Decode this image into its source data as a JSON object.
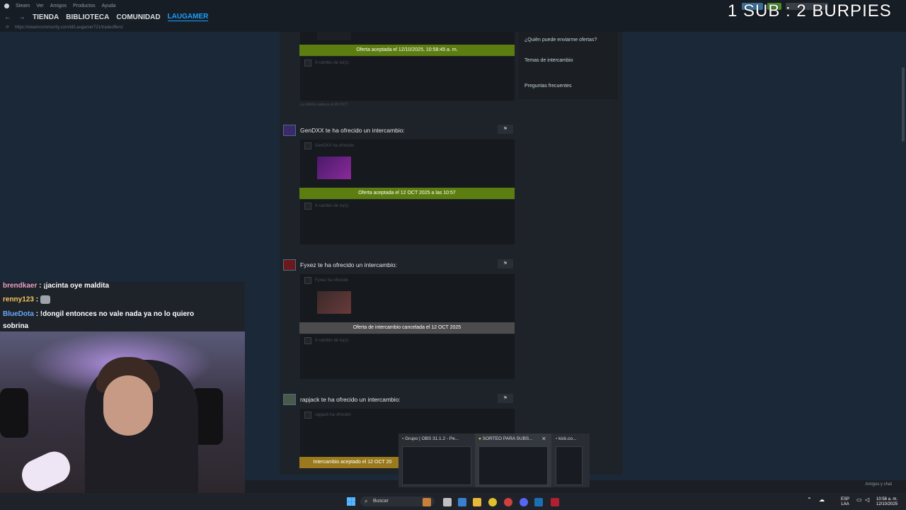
{
  "menubar": {
    "items": [
      "Steam",
      "Ver",
      "Amigos",
      "Productos",
      "Ayuda"
    ]
  },
  "navbar": {
    "back": "←",
    "forward": "→",
    "items": [
      "TIENDA",
      "BIBLIOTECA",
      "COMUNIDAD",
      "LAUGAMER"
    ]
  },
  "url": "https://steamcommunity.com/id/Laugamer721/tradeoffers/",
  "banner": "1 SUB : 2 BURPIES",
  "sidebar": {
    "links": [
      "¿Quién puede enviarme ofertas?",
      "Temas de intercambio",
      "Preguntas frecuentes"
    ]
  },
  "offers": [
    {
      "status": "Oferta aceptada el 12/10/2025, 10:58:45 a. m.",
      "receive_label": "A cambio de tu(s):",
      "expires": "La oferta caduca el 26 OCT"
    },
    {
      "title": "GenDXX te ha ofrecido un intercambio:",
      "offered_label": "GenDXX ha ofrecido",
      "status": "Oferta aceptada el 12 OCT 2025 a las 10:57",
      "receive_label": "A cambio de tu(s):"
    },
    {
      "title": "Fyxez te ha ofrecido un intercambio:",
      "offered_label": "Fyxez ha ofrecido",
      "status": "Oferta de intercambio cancelada el 12 OCT 2025",
      "receive_label": "A cambio de tu(s):"
    },
    {
      "title": "rapjack te ha ofrecido un intercambio:",
      "offered_label": "rapjack ha ofrecido",
      "status": "Intercambio aceptado el 12 OCT 20"
    }
  ],
  "chat": {
    "line1_user": "brendkaer",
    "line1_text": ": ¡jacinta oye maldita",
    "line2_user": "renny123",
    "line2_text": ":",
    "line3_user": "BlueDota",
    "line3_text": ": !dongil entonces no vale nada ya no lo quiero",
    "line3_cont": "sobrina"
  },
  "friends_chat": "Amigos y chat",
  "taskbar": {
    "search_placeholder": "Buscar",
    "lang_top": "ESP",
    "lang_bottom": "LAA",
    "time": "10:58 a. m.",
    "date": "12/10/2025"
  },
  "thumbnails": [
    {
      "title": "Grupo | OBS 31.1.2 - Pe..."
    },
    {
      "title": "SORTEO PARA SUBS..."
    },
    {
      "title": "kick.co..."
    }
  ],
  "colors": {
    "accepted": "#5c7e10",
    "cancelled": "#4c4c4c",
    "accepted_gold": "#9a7a1c",
    "nav_active": "#1a9fff"
  }
}
